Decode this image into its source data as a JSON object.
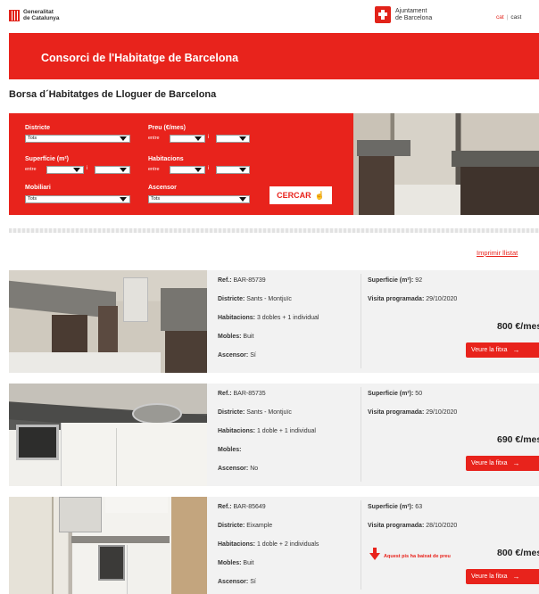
{
  "header": {
    "generalitat_line1": "Generalitat",
    "generalitat_line2": "de Catalunya",
    "ajuntament_line1": "Ajuntament",
    "ajuntament_line2": "de Barcelona",
    "lang_cat": "cat",
    "lang_sep": "|",
    "lang_cast": "cast"
  },
  "banner": {
    "title": "Consorci de l'Habitatge de Barcelona"
  },
  "page": {
    "title": "Borsa d´Habitatges de Lloguer de Barcelona"
  },
  "search": {
    "districte_label": "Districte",
    "districte_value": "Tots",
    "preu_label": "Preu (€/mes)",
    "superficie_label": "Superfície (m²)",
    "habitacions_label": "Habitacions",
    "mobiliari_label": "Mobiliari",
    "mobiliari_value": "Tots",
    "ascensor_label": "Ascensor",
    "ascensor_value": "Tots",
    "entre": "entre",
    "i": "i",
    "button_label": "CERCAR"
  },
  "print_link": "Imprimir llistat",
  "labels": {
    "ref": "Ref.:",
    "districte": "Districte:",
    "habitacions": "Habitacions:",
    "mobles": "Mobles:",
    "ascensor": "Ascensor:",
    "superficie": "Superficie (m²):",
    "visita": "Visita programada:",
    "detail_button": "Veure la fitxa"
  },
  "listings": [
    {
      "ref": "BAR-85739",
      "districte": "Sants - Montjuïc",
      "habitacions": "3 dobles + 1 individual",
      "mobles": "Buit",
      "ascensor": "Sí",
      "superficie": "92",
      "visita": "29/10/2020",
      "price": "800 €/mes"
    },
    {
      "ref": "BAR-85735",
      "districte": "Sants - Montjuïc",
      "habitacions": "1 doble + 1 individual",
      "mobles": "",
      "ascensor": "No",
      "superficie": "50",
      "visita": "29/10/2020",
      "price": "690 €/mes"
    },
    {
      "ref": "BAR-85649",
      "districte": "Eixample",
      "habitacions": "1 doble + 2 individuals",
      "mobles": "Buit",
      "ascensor": "Sí",
      "superficie": "63",
      "visita": "28/10/2020",
      "price": "800 €/mes",
      "price_drop": "Aquest pis ha baixat de preu"
    }
  ],
  "colors": {
    "brand_red": "#e8231c"
  }
}
